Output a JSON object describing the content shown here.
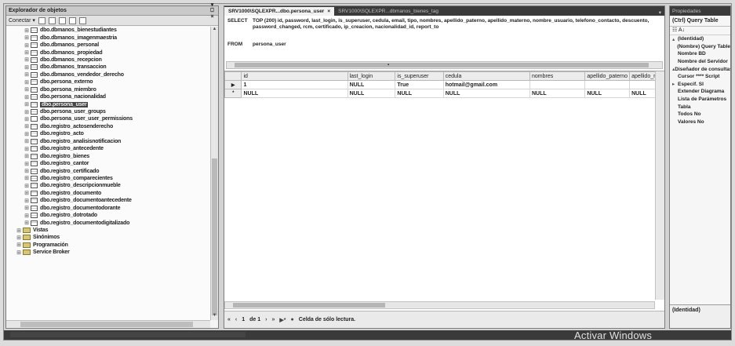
{
  "object_explorer": {
    "title": "Explorador de objetos",
    "title_controls": "▾ ⎕ ×",
    "connect_label": "Conectar ▾",
    "tree": [
      {
        "label": "dbo.dbmanos_bienestudiantes",
        "kind": "table",
        "sel": false
      },
      {
        "label": "dbo.dbmanos_imagenmaestria",
        "kind": "table",
        "sel": false
      },
      {
        "label": "dbo.dbmanos_personal",
        "kind": "table",
        "sel": false
      },
      {
        "label": "dbo.dbmanos_propiedad",
        "kind": "table",
        "sel": false
      },
      {
        "label": "dbo.dbmanos_recepcion",
        "kind": "table",
        "sel": false
      },
      {
        "label": "dbo.dbmanos_transaccion",
        "kind": "table",
        "sel": false
      },
      {
        "label": "dbo.dbmanos_vendedor_derecho",
        "kind": "table",
        "sel": false
      },
      {
        "label": "dbo.persona_externo",
        "kind": "table",
        "sel": false
      },
      {
        "label": "dbo.persona_miembro",
        "kind": "table",
        "sel": false
      },
      {
        "label": "dbo.persona_nacionalidad",
        "kind": "table",
        "sel": false
      },
      {
        "label": "dbo.persona_user",
        "kind": "table",
        "sel": true
      },
      {
        "label": "dbo.persona_user_groups",
        "kind": "table",
        "sel": false
      },
      {
        "label": "dbo.persona_user_user_permissions",
        "kind": "table",
        "sel": false
      },
      {
        "label": "dbo.registro_actosenderecho",
        "kind": "table",
        "sel": false
      },
      {
        "label": "dbo.registro_acto",
        "kind": "table",
        "sel": false
      },
      {
        "label": "dbo.registro_analisisnotificacion",
        "kind": "table",
        "sel": false
      },
      {
        "label": "dbo.registro_antecedente",
        "kind": "table",
        "sel": false
      },
      {
        "label": "dbo.registro_bienes",
        "kind": "table",
        "sel": false
      },
      {
        "label": "dbo.registro_cantor",
        "kind": "table",
        "sel": false
      },
      {
        "label": "dbo.registro_certificado",
        "kind": "table",
        "sel": false
      },
      {
        "label": "dbo.registro_comparecientes",
        "kind": "table",
        "sel": false
      },
      {
        "label": "dbo.registro_descripcionmueble",
        "kind": "table",
        "sel": false
      },
      {
        "label": "dbo.registro_documento",
        "kind": "table",
        "sel": false
      },
      {
        "label": "dbo.registro_documentoantecedente",
        "kind": "table",
        "sel": false
      },
      {
        "label": "dbo.registro_documentodorante",
        "kind": "table",
        "sel": false
      },
      {
        "label": "dbo.registro_dotrotado",
        "kind": "table",
        "sel": false
      },
      {
        "label": "dbo.registro_documentodigitalizado",
        "kind": "table",
        "sel": false
      },
      {
        "label": "Vistas",
        "kind": "folder",
        "sel": false
      },
      {
        "label": "Sinónimos",
        "kind": "folder",
        "sel": false
      },
      {
        "label": "Programación",
        "kind": "folder",
        "sel": false
      },
      {
        "label": "Service Broker",
        "kind": "folder",
        "sel": false
      }
    ]
  },
  "document": {
    "tabs": [
      {
        "label": "SRV1000\\SQLEXPR...dbo.persona_user",
        "close": "×",
        "active": true
      },
      {
        "label": "SRV1000\\SQLEXPR...dbmanos_bienes_tag",
        "close": "",
        "active": false
      }
    ],
    "tab_dropdown": "▾",
    "sql": {
      "select_kw": "SELECT",
      "select_text": "TOP (200) id, password, last_login, is_superuser, cedula, email, tipo, nombres, apellido_paterno, apellido_materno, nombre_usuario, telefono_contacto, descuento, password_changed, rcm, certificado, ip_creacion, nacionalidad_id, report_to",
      "from_kw": "FROM",
      "from_text": "persona_user"
    },
    "grid": {
      "columns": [
        "id",
        "last_login",
        "is_superuser",
        "cedula",
        "nombres",
        "apellido_paterno",
        "apellido_m"
      ],
      "rows": [
        {
          "marker": "▶",
          "cells": [
            "1",
            "NULL",
            "True",
            "hotmail@gmail.com",
            "",
            "",
            ""
          ]
        },
        {
          "marker": "*",
          "cells": [
            "NULL",
            "NULL",
            "NULL",
            "NULL",
            "NULL",
            "NULL",
            "NULL"
          ]
        }
      ]
    },
    "nav": {
      "first": "«",
      "prev": "‹",
      "position": "1",
      "of_label": "de 1",
      "next": "›",
      "last": "»",
      "new": "▶*",
      "stop": "●",
      "status": "Celda de sólo lectura."
    }
  },
  "properties": {
    "title": "Propiedades",
    "selected": "(Ctrl) Query Table",
    "toolbar": "☷ A↓",
    "rows": [
      {
        "pm": "▴",
        "label": "(Identidad)"
      },
      {
        "pm": "",
        "label": "(Nombre) Query Table"
      },
      {
        "pm": "",
        "label": "Nombre BD"
      },
      {
        "pm": "",
        "label": "Nombre del Servidor"
      },
      {
        "pm": "▴",
        "label": "Diseñador de consultas"
      },
      {
        "pm": "",
        "label": "Cursor **** Script"
      },
      {
        "pm": "▸",
        "label": "Especif. SI"
      },
      {
        "pm": "",
        "label": "Extender Diagrama"
      },
      {
        "pm": "",
        "label": "Lista de Parámetros"
      },
      {
        "pm": "",
        "label": "Tabla"
      },
      {
        "pm": "",
        "label": "Todos No"
      },
      {
        "pm": "",
        "label": "Valores No"
      }
    ],
    "desc": "(Identidad)"
  },
  "watermark": "Activar Windows"
}
